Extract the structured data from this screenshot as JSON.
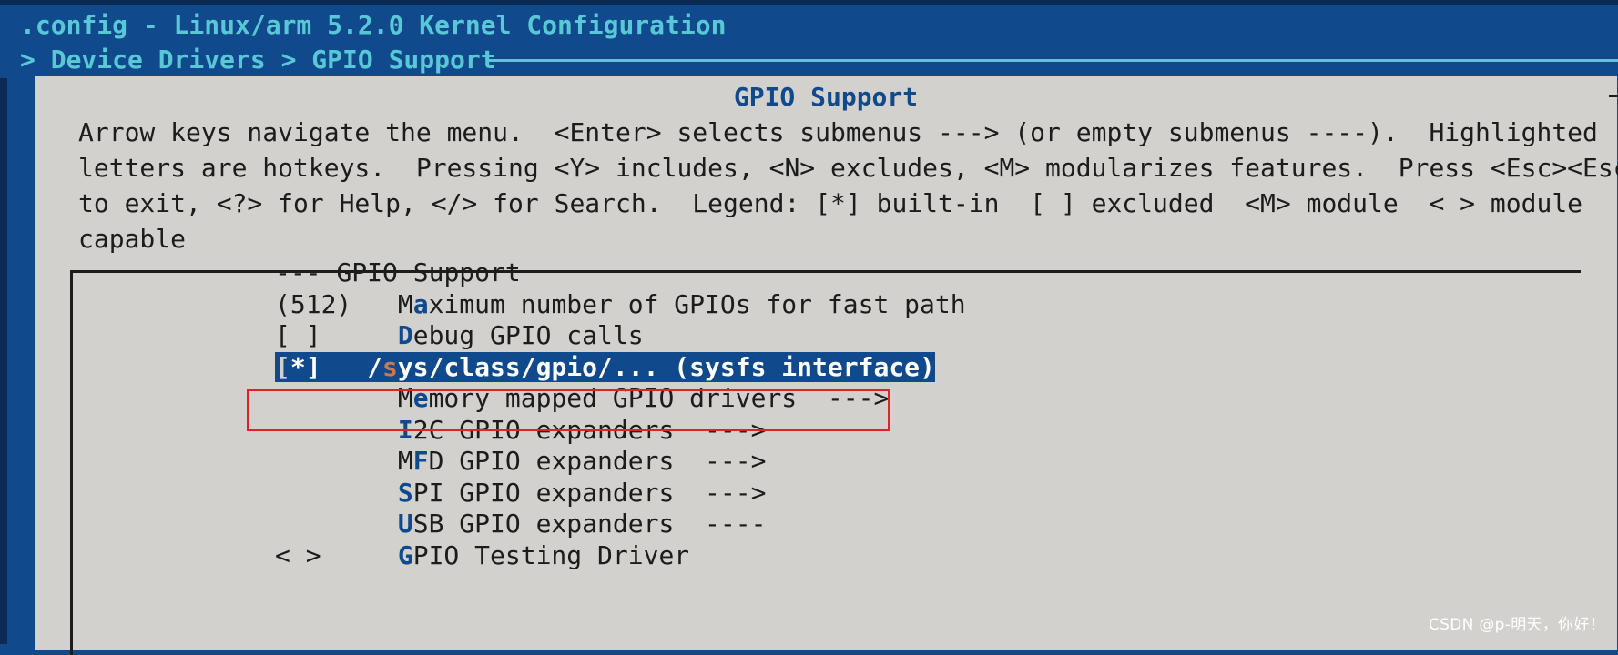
{
  "window": {
    "title": ".config - Linux/arm 5.2.0 Kernel Configuration",
    "breadcrumb": "> Device Drivers > GPIO Support"
  },
  "dialog": {
    "title": "GPIO Support",
    "help_lines": [
      "Arrow keys navigate the menu.  <Enter> selects submenus ---> (or empty submenus ----).  Highlighted",
      "letters are hotkeys.  Pressing <Y> includes, <N> excludes, <M> modularizes features.  Press <Esc><Esc>",
      "to exit, <?> for Help, </> for Search.  Legend: [*] built-in  [ ] excluded  <M> module  < > module",
      "capable"
    ]
  },
  "menu": {
    "items": [
      {
        "state": "---",
        "pre": "",
        "hotkey": "",
        "rest": "GPIO Support",
        "selected": false
      },
      {
        "state": "(512)",
        "pre": "M",
        "hotkey": "a",
        "rest": "ximum number of GPIOs for fast path",
        "selected": false
      },
      {
        "state": "[ ]",
        "pre": "",
        "hotkey": "D",
        "rest": "ebug GPIO calls",
        "selected": false
      },
      {
        "state": "[*]",
        "pre": "/",
        "hotkey": "s",
        "rest": "ys/class/gpio/... (sysfs interface)",
        "selected": true
      },
      {
        "state": "",
        "pre": "M",
        "hotkey": "e",
        "rest": "mory mapped GPIO drivers  --->",
        "selected": false
      },
      {
        "state": "",
        "pre": "",
        "hotkey": "I",
        "rest": "2C GPIO expanders  --->",
        "selected": false
      },
      {
        "state": "",
        "pre": "M",
        "hotkey": "F",
        "rest": "D GPIO expanders  --->",
        "selected": false
      },
      {
        "state": "",
        "pre": "",
        "hotkey": "S",
        "rest": "PI GPIO expanders  --->",
        "selected": false
      },
      {
        "state": "",
        "pre": "",
        "hotkey": "U",
        "rest": "SB GPIO expanders  ----",
        "selected": false
      },
      {
        "state": "< >",
        "pre": "",
        "hotkey": "G",
        "rest": "PIO Testing Driver",
        "selected": false
      }
    ]
  },
  "watermark": "CSDN @p-明天，你好！",
  "colors": {
    "background": "#114a8c",
    "dialog": "#d3d1cd",
    "hotkey": "#114a8c",
    "title_text": "#58c8d6",
    "marker": "#e2202a"
  }
}
